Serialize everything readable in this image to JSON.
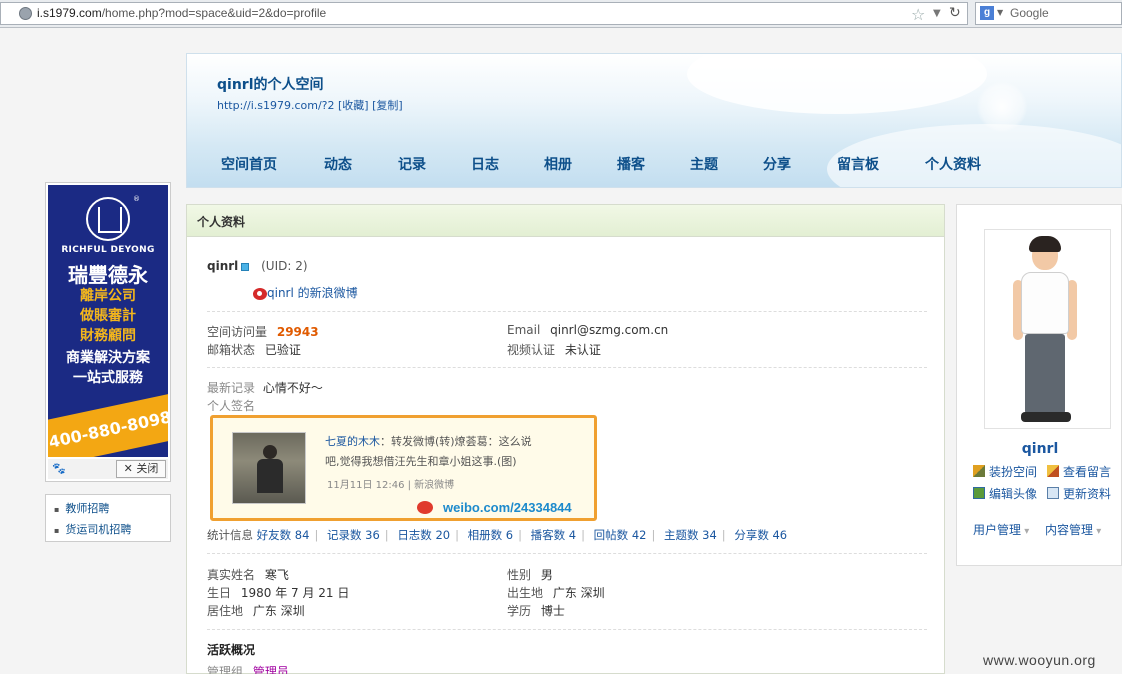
{
  "browser": {
    "url_domain": "i.s1979.com",
    "url_path": "/home.php?mod=space&uid=2&do=profile",
    "search_engine": "Google"
  },
  "header": {
    "space_title": "qinrl的个人空间",
    "space_url": "http://i.s1979.com/?2 [收藏] [复制]",
    "nav": [
      "空间首页",
      "动态",
      "记录",
      "日志",
      "相册",
      "播客",
      "主题",
      "分享",
      "留言板",
      "个人资料"
    ]
  },
  "ad": {
    "brand_en": "RICHFUL DEYONG",
    "brand_cn": "瑞豐德永",
    "lines": [
      "離岸公司",
      "做賬審計",
      "財務顧問",
      "商業解決方案",
      "一站式服務"
    ],
    "phone": "400-880-8098",
    "close_label": "关闭"
  },
  "side_links": [
    "教师招聘",
    "货运司机招聘"
  ],
  "profile": {
    "section_title": "个人资料",
    "username": "qinrl",
    "uid": "(UID: 2)",
    "weibo_link": "qinrl 的新浪微博",
    "visits_label": "空间访问量",
    "visits_value": "29943",
    "email_label": "Email",
    "email_value": "qinrl@szmg.com.cn",
    "mail_status_label": "邮箱状态",
    "mail_status_value": "已验证",
    "video_label": "视频认证",
    "video_value": "未认证",
    "latest_record_label": "最新记录",
    "latest_record_value": "心情不好～",
    "signature_label": "个人签名",
    "weibo_card": {
      "author": "七夏的木木",
      "text_1": "：转发微博(转)燎荟葛：这么说",
      "text_2": "吧,觉得我想借汪先生和章小姐这事.(图)",
      "time": "11月11日 12:46 | 新浪微博",
      "link": "weibo.com/24334844"
    },
    "stats_label": "统计信息",
    "stats": [
      "好友数 84",
      "记录数 36",
      "日志数 20",
      "相册数 6",
      "播客数 4",
      "回帖数 42",
      "主题数 34",
      "分享数 46"
    ],
    "real_name_label": "真实姓名",
    "real_name_value": "寒飞",
    "gender_label": "性别",
    "gender_value": "男",
    "birthday_label": "生日",
    "birthday_value": "1980 年 7 月 21 日",
    "birthplace_label": "出生地",
    "birthplace_value": "广东 深圳",
    "residence_label": "居住地",
    "residence_value": "广东 深圳",
    "education_label": "学历",
    "education_value": "博士",
    "activity_title": "活跃概况",
    "group_label": "管理组",
    "group_value": "管理员"
  },
  "sidebar": {
    "username": "qinrl",
    "actions": [
      "装扮空间",
      "查看留言",
      "编辑头像",
      "更新资料"
    ],
    "menus": [
      "用户管理",
      "内容管理"
    ]
  },
  "watermark": "www.wooyun.org",
  "colors": {
    "link": "#1b57a0",
    "visits": "#e05a00",
    "weibo_border": "#f0a030",
    "admin": "#a000a0"
  }
}
